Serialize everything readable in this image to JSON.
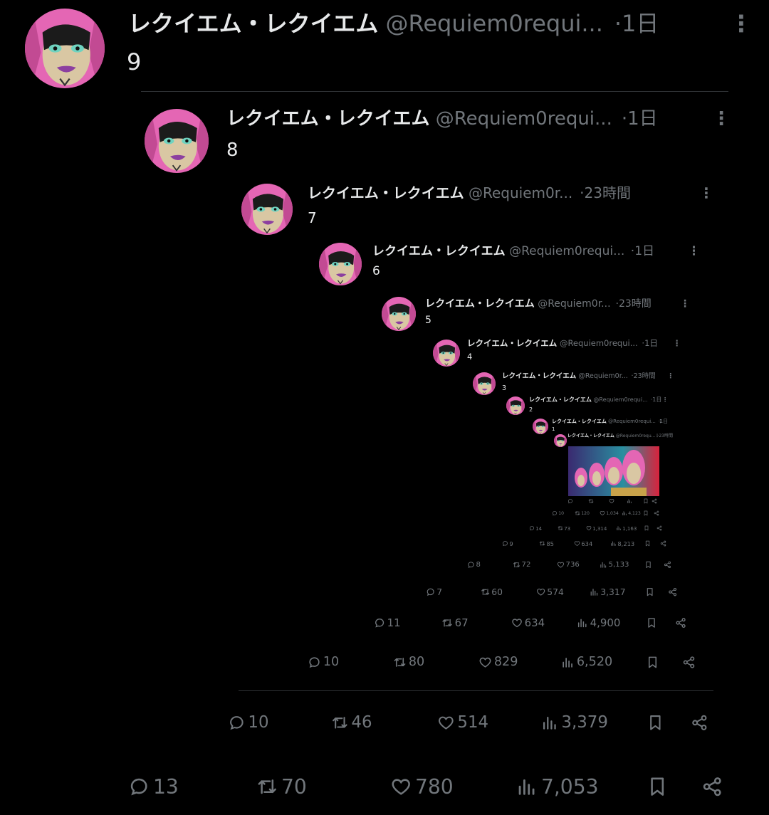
{
  "colors": {
    "background": "#000000",
    "text": "#e7e9ea",
    "muted": "#71767b",
    "divider": "#2f3336",
    "avatar_pink": "#e466b4"
  },
  "posts": [
    {
      "level": 9,
      "name": "レクイエム・レクイエム",
      "handle": "@Requiem0requi...",
      "sep": "·",
      "time": "1日",
      "menu": "⋮",
      "text": "9",
      "actions": {
        "reply": "13",
        "repost": "70",
        "like": "780",
        "views": "7,053"
      }
    },
    {
      "level": 8,
      "name": "レクイエム・レクイエム",
      "handle": "@Requiem0requi...",
      "sep": "·",
      "time": "1日",
      "menu": "⋮",
      "text": "8",
      "actions": {
        "reply": "10",
        "repost": "46",
        "like": "514",
        "views": "3,379"
      }
    },
    {
      "level": 7,
      "name": "レクイエム・レクイエム",
      "handle": "@Requiem0r...",
      "sep": "·",
      "time": "23時間",
      "menu": "⋮",
      "text": "7",
      "actions": {
        "reply": "10",
        "repost": "80",
        "like": "829",
        "views": "6,520"
      }
    },
    {
      "level": 6,
      "name": "レクイエム・レクイエム",
      "handle": "@Requiem0requi...",
      "sep": "·",
      "time": "1日",
      "menu": "⋮",
      "text": "6",
      "actions": {
        "reply": "11",
        "repost": "67",
        "like": "634",
        "views": "4,900"
      }
    },
    {
      "level": 5,
      "name": "レクイエム・レクイエム",
      "handle": "@Requiem0r...",
      "sep": "·",
      "time": "23時間",
      "menu": "⋮",
      "text": "5",
      "actions": {
        "reply": "7",
        "repost": "60",
        "like": "574",
        "views": "3,317"
      }
    },
    {
      "level": 4,
      "name": "レクイエム・レクイエム",
      "handle": "@Requiem0requi...",
      "sep": "·",
      "time": "1日",
      "menu": "⋮",
      "text": "4",
      "actions": {
        "reply": "8",
        "repost": "72",
        "like": "736",
        "views": "5,133"
      }
    },
    {
      "level": 3,
      "name": "レクイエム・レクイエム",
      "handle": "@Requiem0r...",
      "sep": "·",
      "time": "23時間",
      "menu": "⋮",
      "text": "3",
      "actions": {
        "reply": "9",
        "repost": "85",
        "like": "634",
        "views": "8,213"
      }
    },
    {
      "level": 2,
      "name": "レクイエム・レクイエム",
      "handle": "@Requiem0requi...",
      "sep": "·",
      "time": "1日",
      "menu": "⋮",
      "text": "2",
      "actions": {
        "reply": "14",
        "repost": "73",
        "like": "1,314",
        "views": "1,163"
      }
    },
    {
      "level": 1,
      "name": "レクイエム・レクイエム",
      "handle": "@Requiem0requi...",
      "sep": "·",
      "time": "1日",
      "menu": "⋮",
      "text": "1",
      "actions": {
        "reply": "10",
        "repost": "120",
        "like": "1,034",
        "views": "4,123"
      }
    },
    {
      "level": 0,
      "name": "レクイエム・レクイエム",
      "handle": "@Requiem0requ...",
      "sep": "·",
      "time": "23時間",
      "menu": "⋮",
      "text": "",
      "actions": {
        "reply": "",
        "repost": "",
        "like": "",
        "views": ""
      }
    }
  ]
}
